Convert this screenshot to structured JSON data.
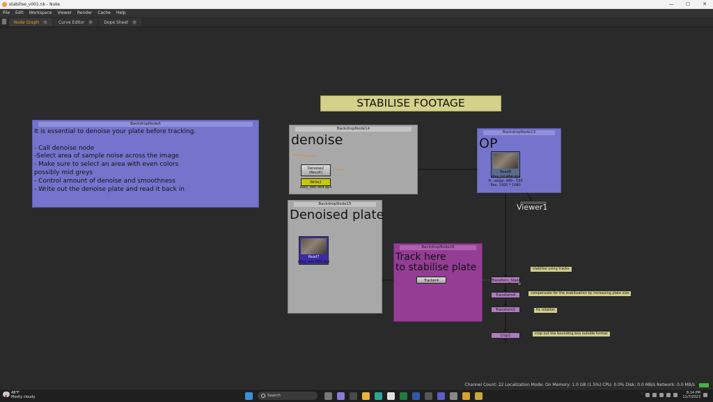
{
  "window": {
    "title": "stabilise_v001.nk - Nuke",
    "controls": [
      "—",
      "☐",
      "✕"
    ]
  },
  "menu": [
    "File",
    "Edit",
    "Workspace",
    "Viewer",
    "Render",
    "Cache",
    "Help"
  ],
  "tabs": [
    {
      "label": "Node Graph",
      "active": true
    },
    {
      "label": "Curve Editor",
      "active": false
    },
    {
      "label": "Dope Sheet",
      "active": false
    }
  ],
  "graph": {
    "backdrops": {
      "bd6": {
        "title": "BackdropNode6",
        "text": "It is essential to denoise your plate before tracking.\n\n- Call denoise node\n-Select area of sample noise across the image\n- Make sure to select an area with even colors\npossibly mid greys\n- Control amount of denoise and smoothness\n- Write out the denoise plate and read it back in"
      },
      "bd14": {
        "title": "BackdropNode14",
        "label": "denoise"
      },
      "bd13": {
        "title": "BackdropNode13",
        "label": "OP"
      },
      "bd15": {
        "title": "BackdropNode15",
        "label": "Denoised plate"
      },
      "bd16": {
        "title": "BackdropNode16",
        "label": "Track here\nto stabilise plate"
      }
    },
    "title_banner": "STABILISE FOOTAGE",
    "nodes": {
      "denoise": {
        "name": "Denoise2",
        "sub": "(Result)"
      },
      "write": {
        "name": "Write2",
        "file": "alley_den.484.dpx"
      },
      "read8": {
        "name": "Read8",
        "file": "alley_hd.484.dpx",
        "range": "Fr. range: 480 - 550",
        "res": "Res: 1920 * 1080"
      },
      "read7": {
        "name": "Read7",
        "file": "alley_den.484.dpx"
      },
      "tracker": {
        "name": "Tracker4"
      },
      "stabilise": {
        "name": "Transform_Stabilise1"
      },
      "transform4": {
        "name": "Transform4"
      },
      "transform5": {
        "name": "Transform5"
      },
      "crop": {
        "name": "Crop1"
      },
      "viewer": {
        "name": "Viewer1"
      }
    },
    "input_labels": {
      "source": "Source",
      "analysis": "Analysis",
      "mask": "mask"
    },
    "stickies": {
      "s1": "stabilise using tracks",
      "s2": "compensate for the stabilization by increasing plate size",
      "s3": "fix rotation",
      "s4": "crop out the bounding box outside format"
    }
  },
  "status": "Channel Count: 22  Localization Mode: On  Memory: 1.0 GB (1.5%)  CPU: 0.0%  Disk: 0.0 MB/s  Network: 0.0 MB/s",
  "taskbar": {
    "weather_temp": "48°F",
    "weather_desc": "Mostly cloudy",
    "search": "Search",
    "time": "8:14 PM",
    "date": "11/7/2023"
  },
  "colors": {
    "backdrop_blue": "#7474cc",
    "backdrop_gray": "#a8a8a8",
    "backdrop_purple": "#953d95",
    "banner": "#d4d28a",
    "write_node": "#c8c800",
    "transform_node": "#b07cbd"
  }
}
